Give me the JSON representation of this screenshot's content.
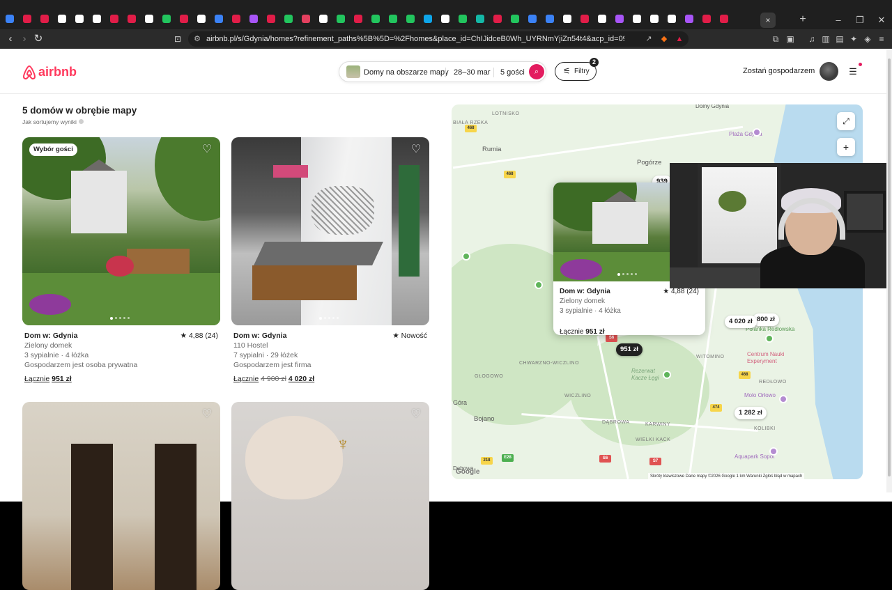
{
  "browser": {
    "url": "airbnb.pl/s/Gdynia/homes?refinement_paths%5B%5D=%2Fhomes&place_id=ChIJidceB0Wh_UYRNmYjiZn54t4&acp_id=09e6e5d2-4ab5-4e71-b35d-e...",
    "active_tab_close": "×",
    "new_tab": "+",
    "tab_colors": [
      "#3b82f6",
      "#e11d48",
      "#e11d48",
      "#ffffff",
      "#ffffff",
      "#ffffff",
      "#e11d48",
      "#e11d48",
      "#ffffff",
      "#22c55e",
      "#e11d48",
      "#ffffff",
      "#3b82f6",
      "#e11d48",
      "#a855f7",
      "#e11d48",
      "#22c55e",
      "#e4405f",
      "#ffffff",
      "#22c55e",
      "#e11d48",
      "#22c55e",
      "#22c55e",
      "#22c55e",
      "#0ea5e9",
      "#ffffff",
      "#22c55e",
      "#14b8a6",
      "#e11d48",
      "#22c55e",
      "#3b82f6",
      "#3b82f6",
      "#ffffff",
      "#e11d48",
      "#ffffff",
      "#a855f7",
      "#ffffff",
      "#ffffff",
      "#ffffff",
      "#a855f7",
      "#e11d48",
      "#e11d48"
    ]
  },
  "header": {
    "logo": "airbnb",
    "search": {
      "location": "Domy na obszarze mapy",
      "dates": "28–30 mar",
      "guests": "5 gości"
    },
    "filters_label": "Filtry",
    "filters_count": "2",
    "host_link": "Zostań gospodarzem",
    "brand_color": "#ff385c"
  },
  "results": {
    "title": "5 domów w obrębie mapy",
    "subtitle": "Jak sortujemy wyniki"
  },
  "listings": [
    {
      "badge": "Wybór gości",
      "title": "Dom w: Gdynia",
      "rating": "★ 4,88 (24)",
      "name": "Zielony domek",
      "details": "3 sypialnie · 4 łóżka",
      "host": "Gospodarzem jest osoba prywatna",
      "price_label": "Łącznie",
      "price_old": "",
      "price": "951 zł"
    },
    {
      "badge": "",
      "title": "Dom w: Gdynia",
      "rating": "★ Nowość",
      "name": "110 Hostel",
      "details": "7 sypialni · 29 łóżek",
      "host": "Gospodarzem jest firma",
      "price_label": "Łącznie",
      "price_old": "4 900 zł",
      "price": "4 020 zł"
    }
  ],
  "map": {
    "towns": [
      "Rumia",
      "Pogórze",
      "Dolny Gdynia",
      "Plaża Gdynia",
      "Gdynia"
    ],
    "districts": [
      "LOTNISKO",
      "BIAŁA RZEKA",
      "CHWARZNO-WICZLINO",
      "GŁOGOWO",
      "WICZLINO",
      "DĄBROWA",
      "KARWINY",
      "WIELKI KACK",
      "WITOMINO",
      "REDŁOWO",
      "KOLIBKI",
      "Góra",
      "Bojano",
      "Dębowa"
    ],
    "pois": [
      "Polanka Redłowska",
      "Centrum Nauki Experyment",
      "Molo Orłowo",
      "Aquapark Sopot",
      "Rezerwat Kacze Łęgi"
    ],
    "pins": [
      "951 zł",
      "4 020 zł",
      "1 282 zł",
      "939",
      "800 zł"
    ],
    "road_numbers": [
      "468",
      "468",
      "468",
      "474",
      "218",
      "E28",
      "S6",
      "S6",
      "S7"
    ],
    "popup": {
      "title": "Dom w: Gdynia",
      "rating": "★ 4,88 (24)",
      "name": "Zielony domek",
      "details": "3 sypialnie · 4 łóżka",
      "price_label": "Łącznie",
      "price": "951 zł"
    },
    "footer": "Skróty klawiszowe    Dane mapy ©2026 Google    1 km    Warunki    Zgłoś błąd w mapach",
    "google": "Google"
  }
}
